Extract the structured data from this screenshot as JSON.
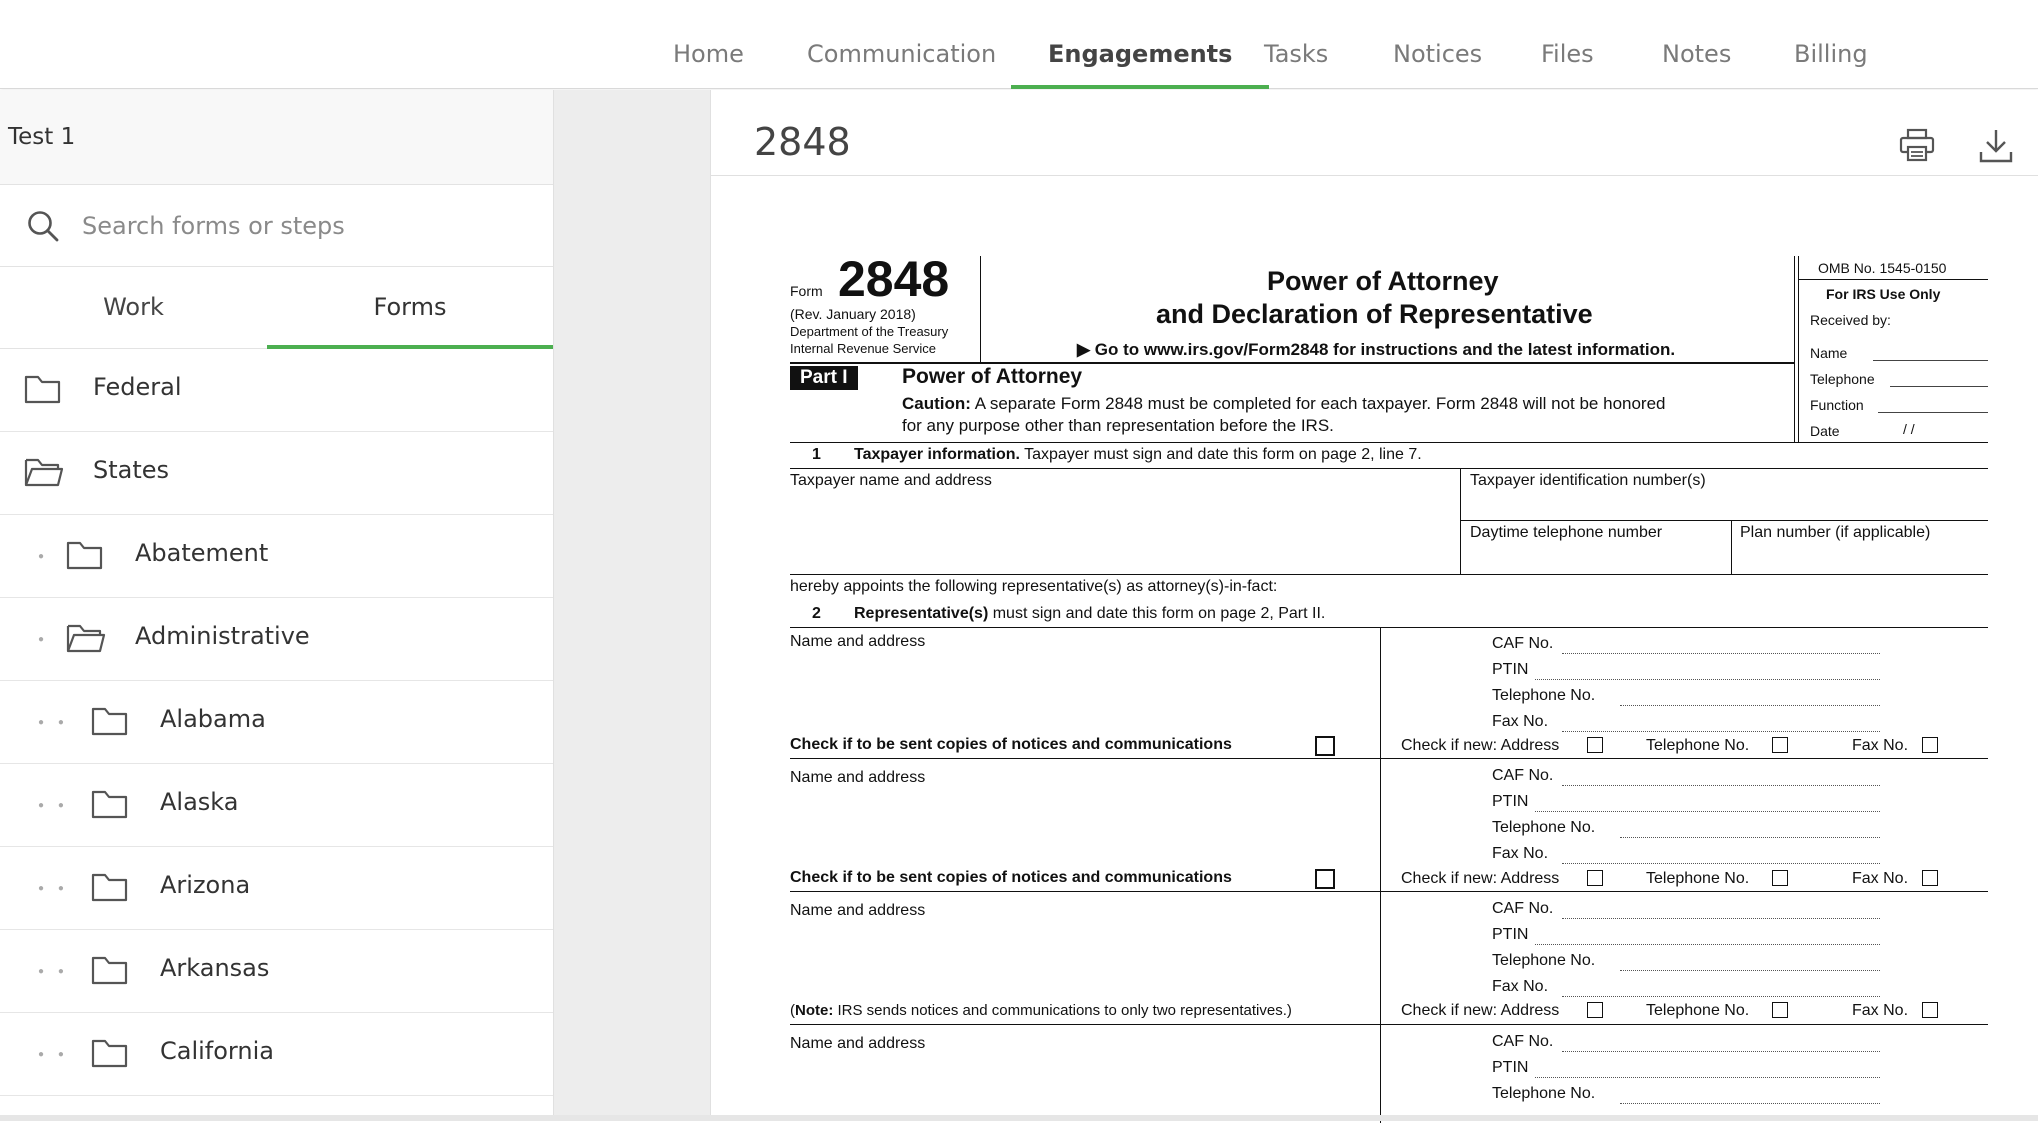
{
  "nav": {
    "tabs": [
      {
        "label": "Home"
      },
      {
        "label": "Communication"
      },
      {
        "label": "Engagements"
      },
      {
        "label": "Tasks"
      },
      {
        "label": "Notices"
      },
      {
        "label": "Files"
      },
      {
        "label": "Notes"
      },
      {
        "label": "Billing"
      }
    ],
    "active": "Engagements"
  },
  "sidebar": {
    "title": "Test 1",
    "search_placeholder": "Search forms or steps",
    "tabs": [
      {
        "label": "Work"
      },
      {
        "label": "Forms"
      }
    ],
    "active_tab": "Forms",
    "tree": [
      {
        "label": "Federal",
        "icon": "folder-icon"
      },
      {
        "label": "States",
        "icon": "folder-open-icon"
      },
      {
        "label": "Abatement",
        "icon": "folder-icon"
      },
      {
        "label": "Administrative",
        "icon": "folder-open-icon"
      },
      {
        "label": "Alabama",
        "icon": "folder-icon"
      },
      {
        "label": "Alaska",
        "icon": "folder-icon"
      },
      {
        "label": "Arizona",
        "icon": "folder-icon"
      },
      {
        "label": "Arkansas",
        "icon": "folder-icon"
      },
      {
        "label": "California",
        "icon": "folder-icon"
      }
    ]
  },
  "document": {
    "title": "2848",
    "actions": [
      "print-icon",
      "download-icon"
    ]
  },
  "form": {
    "form_word": "Form",
    "number": "2848",
    "rev": "(Rev. January 2018)",
    "dept": "Department of the Treasury",
    "irs": "Internal Revenue Service",
    "title1": "Power of Attorney",
    "title2": "and Declaration of Representative",
    "goto": "▶ Go to www.irs.gov/Form2848 for instructions and the latest information.",
    "omb": "OMB No. 1545-0150",
    "irs_use": "For IRS Use Only",
    "received": "Received by:",
    "name": "Name",
    "telephone": "Telephone",
    "function": "Function",
    "date": "Date",
    "date_slashes": "/        /",
    "part": "Part I",
    "part_title": "Power of Attorney",
    "caution_b": "Caution:",
    "caution": " A separate Form 2848 must be completed for each taxpayer. Form 2848 will not be honored",
    "caution2": "for any purpose other than representation before the IRS.",
    "l1_num": "1",
    "l1_b": "Taxpayer information.",
    "l1": " Taxpayer must sign and date this form on page 2, line 7.",
    "tp_name": "Taxpayer name and address",
    "tp_id": "Taxpayer identification number(s)",
    "tp_phone": "Daytime telephone number",
    "tp_plan": "Plan number (if applicable)",
    "appoints": "hereby appoints the following representative(s) as attorney(s)-in-fact:",
    "l2_num": "2",
    "l2_b": "Representative(s)",
    "l2": " must sign and date this form on page 2, Part II.",
    "name_addr": "Name and address",
    "caf": "CAF No.",
    "ptin": "PTIN",
    "tel_no": "Telephone No.",
    "fax_no": "Fax No.",
    "check_copies": "Check if to be sent copies of notices and communications",
    "check_new": "Check if new: Address",
    "note_b": "Note:",
    "note": " IRS sends notices and communications to only two representatives.)",
    "note_open": "("
  },
  "colors": {
    "accent": "#4caf50"
  }
}
